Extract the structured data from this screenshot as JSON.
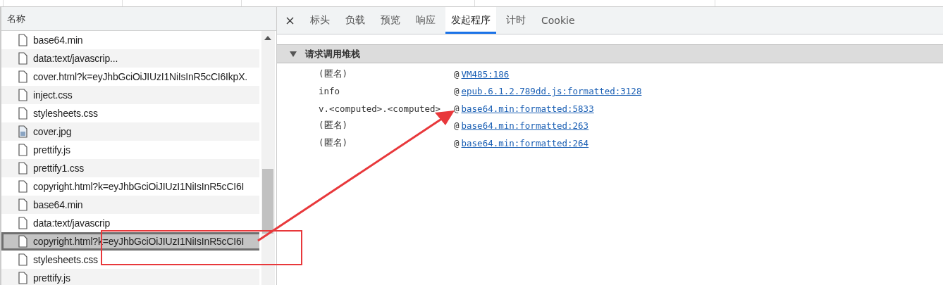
{
  "name_column": {
    "header": "名称"
  },
  "requests": [
    {
      "name": "base64.min",
      "kind": "document",
      "selected": false
    },
    {
      "name": "data:text/javascrip...",
      "kind": "document",
      "selected": false
    },
    {
      "name": "cover.html?k=eyJhbGciOiJIUzI1NiIsInR5cCI6IkpX.",
      "kind": "document",
      "selected": false
    },
    {
      "name": "inject.css",
      "kind": "document",
      "selected": false
    },
    {
      "name": "stylesheets.css",
      "kind": "document",
      "selected": false
    },
    {
      "name": "cover.jpg",
      "kind": "image",
      "selected": false
    },
    {
      "name": "prettify.js",
      "kind": "document",
      "selected": false
    },
    {
      "name": "prettify1.css",
      "kind": "document",
      "selected": false
    },
    {
      "name": "copyright.html?k=eyJhbGciOiJIUzI1NiIsInR5cCI6I",
      "kind": "document",
      "selected": false
    },
    {
      "name": "base64.min",
      "kind": "document",
      "selected": false
    },
    {
      "name": "data:text/javascrip",
      "kind": "document",
      "selected": false
    },
    {
      "name": "copyright.html?k=eyJhbGciOiJIUzI1NiIsInR5cCI6I",
      "kind": "document",
      "selected": true
    },
    {
      "name": "stylesheets.css",
      "kind": "document",
      "selected": false
    },
    {
      "name": "prettify.js",
      "kind": "document",
      "selected": false
    }
  ],
  "tabs": [
    {
      "label": "标头",
      "selected": false
    },
    {
      "label": "负载",
      "selected": false
    },
    {
      "label": "预览",
      "selected": false
    },
    {
      "label": "响应",
      "selected": false
    },
    {
      "label": "发起程序",
      "selected": true
    },
    {
      "label": "计时",
      "selected": false
    },
    {
      "label": "Cookie",
      "selected": false
    }
  ],
  "call_stack": {
    "title": "请求调用堆栈",
    "expanded": true,
    "frames": [
      {
        "function": "(匿名)",
        "at": "@",
        "location": "VM485:186"
      },
      {
        "function": "info",
        "at": "@",
        "location": "epub.6.1.2.789dd.js:formatted:3128"
      },
      {
        "function": "v.<computed>.<computed>",
        "at": "@",
        "location": "base64.min:formatted:5833"
      },
      {
        "function": "(匿名)",
        "at": "@",
        "location": "base64.min:formatted:263"
      },
      {
        "function": "(匿名)",
        "at": "@",
        "location": "base64.min:formatted:264"
      }
    ]
  }
}
